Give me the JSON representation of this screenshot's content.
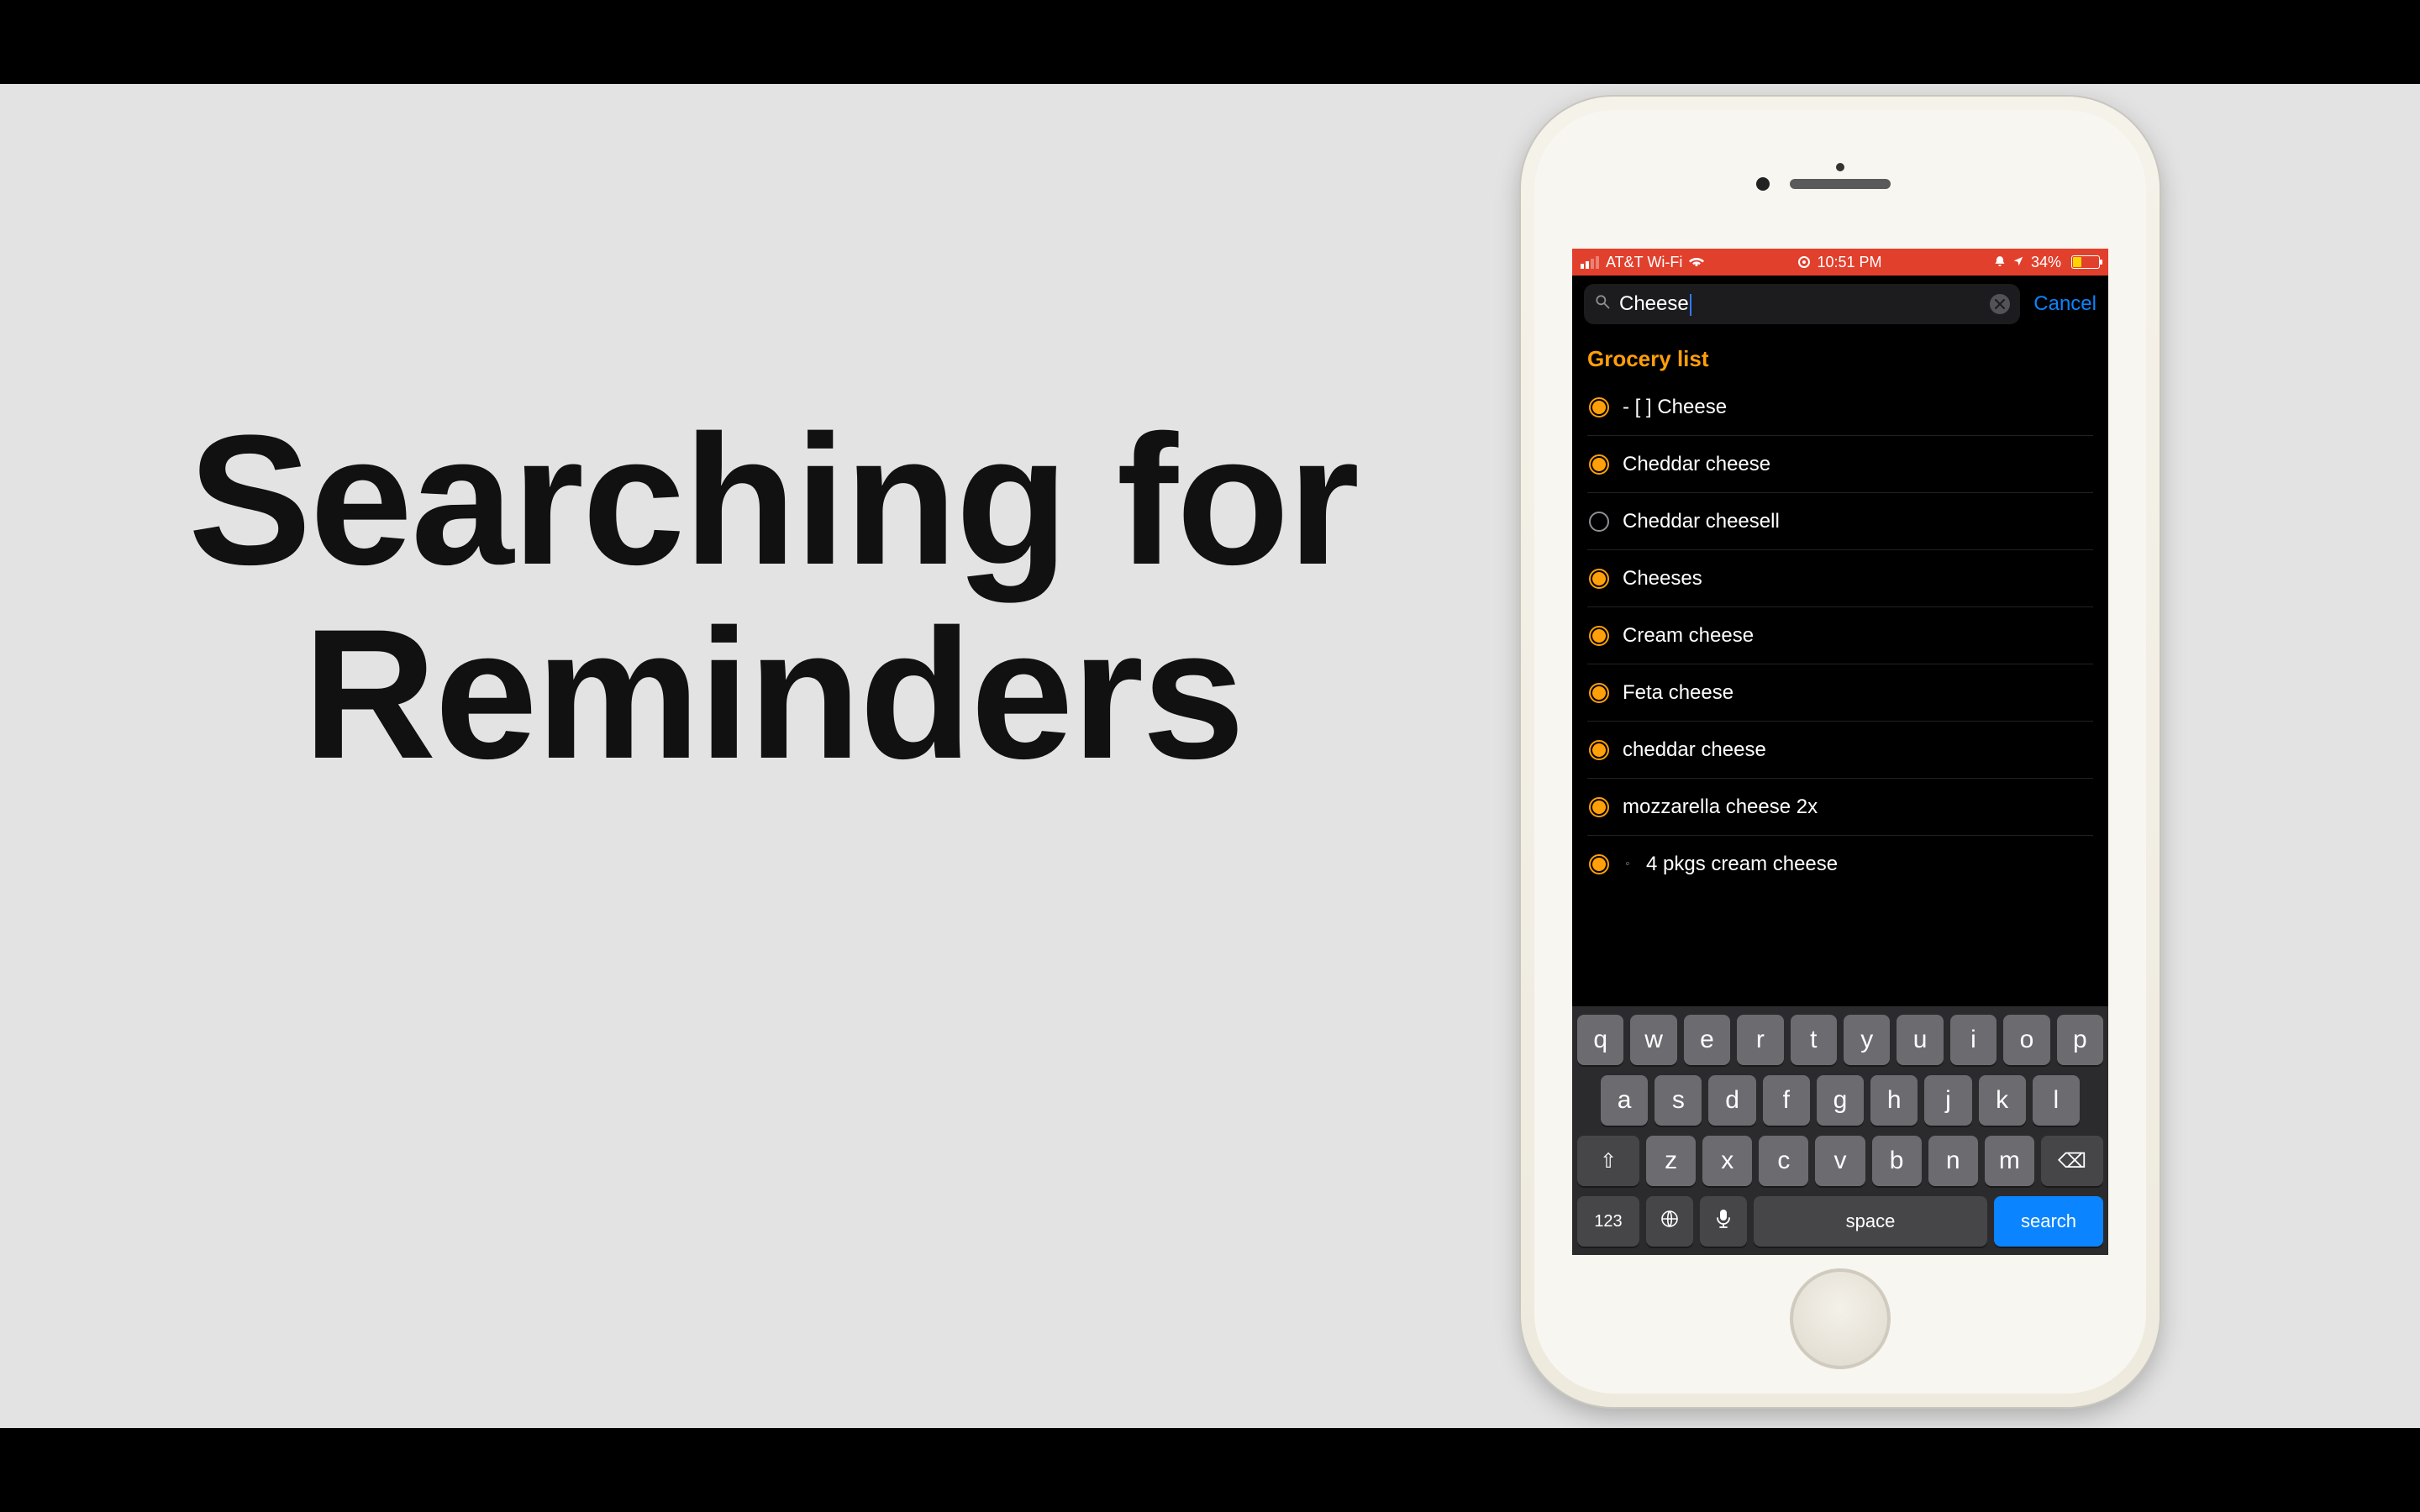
{
  "slide": {
    "title_line1": "Searching for",
    "title_line2": "Reminders"
  },
  "status_bar": {
    "carrier": "AT&T Wi-Fi",
    "time": "10:51 PM",
    "battery_pct": "34%"
  },
  "search": {
    "query": "Cheese",
    "cancel": "Cancel"
  },
  "results": {
    "section_title": "Grocery list",
    "items": [
      {
        "label": "- [ ] Cheese",
        "filled": true,
        "indent": false
      },
      {
        "label": "Cheddar cheese",
        "filled": true,
        "indent": false
      },
      {
        "label": "Cheddar cheesell",
        "filled": false,
        "indent": false
      },
      {
        "label": "Cheeses",
        "filled": true,
        "indent": false
      },
      {
        "label": "Cream cheese",
        "filled": true,
        "indent": false
      },
      {
        "label": "Feta cheese",
        "filled": true,
        "indent": false
      },
      {
        "label": "cheddar cheese",
        "filled": true,
        "indent": false
      },
      {
        "label": "mozzarella cheese 2x",
        "filled": true,
        "indent": false
      },
      {
        "label": "4 pkgs cream cheese",
        "filled": true,
        "indent": true
      }
    ]
  },
  "keyboard": {
    "row1": [
      "q",
      "w",
      "e",
      "r",
      "t",
      "y",
      "u",
      "i",
      "o",
      "p"
    ],
    "row2": [
      "a",
      "s",
      "d",
      "f",
      "g",
      "h",
      "j",
      "k",
      "l"
    ],
    "row3": [
      "z",
      "x",
      "c",
      "v",
      "b",
      "n",
      "m"
    ],
    "space": "space",
    "search": "search",
    "numbers": "123"
  },
  "colors": {
    "accent_orange": "#ff9f0a",
    "ios_blue": "#0a84ff",
    "status_red": "#e1402d"
  }
}
